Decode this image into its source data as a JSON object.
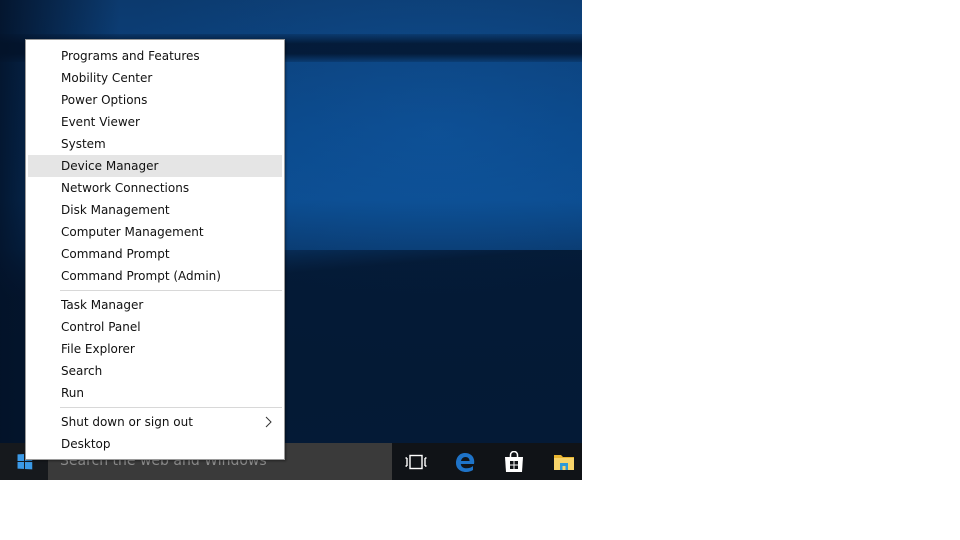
{
  "menu": {
    "groups": [
      [
        {
          "label": "Programs and Features"
        },
        {
          "label": "Mobility Center"
        },
        {
          "label": "Power Options"
        },
        {
          "label": "Event Viewer"
        },
        {
          "label": "System"
        },
        {
          "label": "Device Manager",
          "highlighted": true
        },
        {
          "label": "Network Connections"
        },
        {
          "label": "Disk Management"
        },
        {
          "label": "Computer Management"
        },
        {
          "label": "Command Prompt"
        },
        {
          "label": "Command Prompt (Admin)"
        }
      ],
      [
        {
          "label": "Task Manager"
        },
        {
          "label": "Control Panel"
        },
        {
          "label": "File Explorer"
        },
        {
          "label": "Search"
        },
        {
          "label": "Run"
        }
      ],
      [
        {
          "label": "Shut down or sign out",
          "submenu": true
        },
        {
          "label": "Desktop"
        }
      ]
    ]
  },
  "taskbar": {
    "search_placeholder": "Search the web and Windows",
    "start_icon": "windows-logo-icon",
    "pinned": [
      {
        "name": "task-view",
        "icon": "task-view-icon"
      },
      {
        "name": "edge",
        "icon": "edge-icon",
        "color": "#1e73c8"
      },
      {
        "name": "store",
        "icon": "store-icon"
      },
      {
        "name": "file-explorer",
        "icon": "folder-icon",
        "color": "#f5c542"
      }
    ]
  },
  "colors": {
    "accent": "#3b9ae8",
    "highlight": "#e5e5e5",
    "taskbar": "#101317",
    "search_box": "#3a3a3a"
  }
}
